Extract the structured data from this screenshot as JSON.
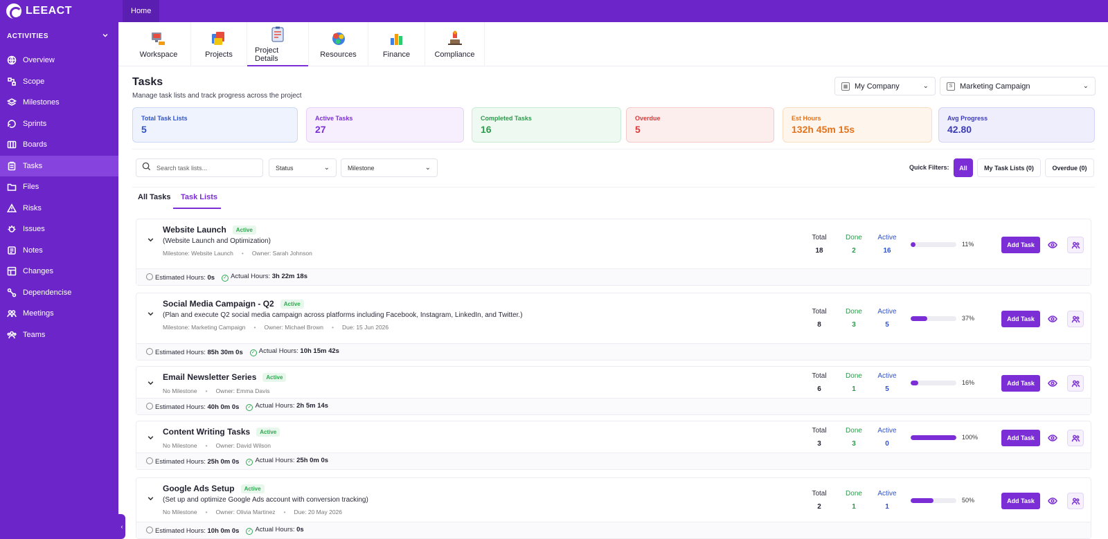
{
  "app": {
    "name": "LEEACT"
  },
  "topbar": {
    "home_label": "Home",
    "collapse_glyph": "‹"
  },
  "sidebar": {
    "section_label": "ACTIVITIES",
    "items": [
      {
        "label": "Overview",
        "icon": "globe-icon"
      },
      {
        "label": "Scope",
        "icon": "scope-icon"
      },
      {
        "label": "Milestones",
        "icon": "layers-icon"
      },
      {
        "label": "Sprints",
        "icon": "sprint-icon"
      },
      {
        "label": "Boards",
        "icon": "board-icon"
      },
      {
        "label": "Tasks",
        "icon": "clipboard-icon",
        "active": true
      },
      {
        "label": "Files",
        "icon": "folder-icon"
      },
      {
        "label": "Risks",
        "icon": "warning-icon"
      },
      {
        "label": "Issues",
        "icon": "bug-icon"
      },
      {
        "label": "Notes",
        "icon": "notes-icon"
      },
      {
        "label": "Changes",
        "icon": "changes-icon"
      },
      {
        "label": "Dependencise",
        "icon": "dependency-icon"
      },
      {
        "label": "Meetings",
        "icon": "meetings-icon"
      },
      {
        "label": "Teams",
        "icon": "teams-icon"
      }
    ]
  },
  "modules": [
    {
      "label": "Workspace",
      "icon": "workspace-icon"
    },
    {
      "label": "Projects",
      "icon": "projects-icon"
    },
    {
      "label": "Project Details",
      "icon": "project-details-icon",
      "active": true
    },
    {
      "label": "Resources",
      "icon": "resources-icon"
    },
    {
      "label": "Finance",
      "icon": "finance-icon"
    },
    {
      "label": "Compliance",
      "icon": "compliance-icon"
    }
  ],
  "header": {
    "title": "Tasks",
    "subtitle": "Manage task lists and track progress across the project",
    "company_select": "My Company",
    "project_select": "Marketing Campaign"
  },
  "stats": [
    {
      "label": "Total Task Lists",
      "value": "5",
      "colors": {
        "bg": "#eef3fd",
        "border": "#c9d8f6",
        "label": "#2f52c9",
        "value": "#2f52c9"
      }
    },
    {
      "label": "Active Tasks",
      "value": "27",
      "colors": {
        "bg": "#f7effd",
        "border": "#e6d3f7",
        "label": "#7b2ed6",
        "value": "#7b2ed6"
      }
    },
    {
      "label": "Completed Tasks",
      "value": "16",
      "colors": {
        "bg": "#eefaf1",
        "border": "#c8ecd2",
        "label": "#2a9a4a",
        "value": "#2a9a4a"
      }
    },
    {
      "label": "Overdue",
      "value": "5",
      "colors": {
        "bg": "#fdeeee",
        "border": "#f6c9c9",
        "label": "#d63a3a",
        "value": "#d63a3a"
      }
    },
    {
      "label": "Est Hours",
      "value": "132h 45m 15s",
      "colors": {
        "bg": "#fef5ec",
        "border": "#f8dfc3",
        "label": "#e0741f",
        "value": "#e0741f"
      }
    },
    {
      "label": "Avg Progress",
      "value": "42.80",
      "colors": {
        "bg": "#eeeefd",
        "border": "#d3d3f5",
        "label": "#3b3bb8",
        "value": "#3b3bb8"
      }
    }
  ],
  "filters": {
    "search_placeholder": "Search task lists...",
    "status_label": "Status",
    "milestone_label": "Milestone",
    "quick_filters_label": "Quick Filters:",
    "quick": [
      {
        "label": "All",
        "on": true
      },
      {
        "label": "My Task Lists (0)"
      },
      {
        "label": "Overdue (0)"
      }
    ]
  },
  "subtabs": [
    {
      "label": "All Tasks"
    },
    {
      "label": "Task Lists",
      "active": true
    }
  ],
  "labels": {
    "total": "Total",
    "done": "Done",
    "active": "Active",
    "add_task": "Add Task",
    "estimated": "Estimated Hours:",
    "actual": "Actual Hours:"
  },
  "task_lists": [
    {
      "title": "Website Launch",
      "status": "Active",
      "description": "(Website Launch and Optimization)",
      "meta": [
        "Milestone: Website Launch",
        "Owner: Sarah Johnson"
      ],
      "total": "18",
      "done": "2",
      "active": "16",
      "progress": 11,
      "progress_label": "11%",
      "estimated": "0s",
      "actual": "3h 22m 18s"
    },
    {
      "title": "Social Media Campaign - Q2",
      "status": "Active",
      "description": "(Plan and execute Q2 social media campaign across platforms including Facebook, Instagram, LinkedIn, and Twitter.)",
      "meta": [
        "Milestone: Marketing Campaign",
        "Owner: Michael Brown",
        "Due: 15 Jun 2026"
      ],
      "total": "8",
      "done": "3",
      "active": "5",
      "progress": 37,
      "progress_label": "37%",
      "estimated": "85h 30m 0s",
      "actual": "10h 15m 42s"
    },
    {
      "title": "Email Newsletter Series",
      "status": "Active",
      "description": "",
      "meta": [
        "No Milestone",
        "Owner: Emma Davis"
      ],
      "total": "6",
      "done": "1",
      "active": "5",
      "progress": 16,
      "progress_label": "16%",
      "estimated": "40h 0m 0s",
      "actual": "2h 5m 14s"
    },
    {
      "title": "Content Writing Tasks",
      "status": "Active",
      "description": "",
      "meta": [
        "No Milestone",
        "Owner: David Wilson"
      ],
      "total": "3",
      "done": "3",
      "active": "0",
      "progress": 100,
      "progress_label": "100%",
      "estimated": "25h 0m 0s",
      "actual": "25h 0m 0s"
    },
    {
      "title": "Google Ads Setup",
      "status": "Active",
      "description": "(Set up and optimize Google Ads account with conversion tracking)",
      "meta": [
        "No Milestone",
        "Owner: Olivia Martinez",
        "Due: 20 May 2026"
      ],
      "total": "2",
      "done": "1",
      "active": "1",
      "progress": 50,
      "progress_label": "50%",
      "estimated": "10h 0m 0s",
      "actual": "0s"
    }
  ]
}
